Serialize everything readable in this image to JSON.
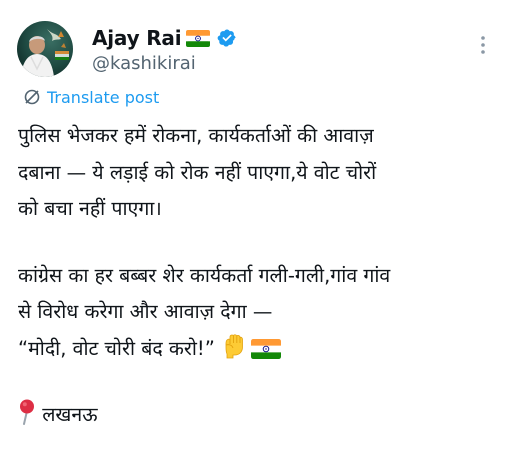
{
  "author": {
    "display_name": "Ajay Rai",
    "handle": "@kashikirai",
    "flag_icon": "india-flag-icon",
    "verified_icon": "verified-badge-icon"
  },
  "actions": {
    "more_icon": "more-vertical-icon",
    "translate_label": "Translate post",
    "translate_icon": "translate-icon"
  },
  "post": {
    "lines": [
      "पुलिस भेजकर हमें रोकना, कार्यकर्ताओं की आवाज़",
      "दबाना — ये लड़ाई को रोक नहीं पाएगा,ये वोट चोरों",
      "को बचा नहीं पाएगा।",
      "कांग्रेस का हर बब्बर शेर कार्यकर्ता गली-गली,गांव गांव",
      "से विरोध करेगा और आवाज़ देगा —",
      "“मोदी, वोट चोरी बंद करो!”",
      "लखनऊ"
    ],
    "emoji": {
      "raised_fist": "raised-fist-emoji",
      "flag": "india-flag-emoji",
      "pin": "round-pushpin-emoji"
    }
  },
  "colors": {
    "text": "#0f1419",
    "secondary": "#536471",
    "link": "#1d9bf0",
    "verified": "#1d9bf0"
  }
}
